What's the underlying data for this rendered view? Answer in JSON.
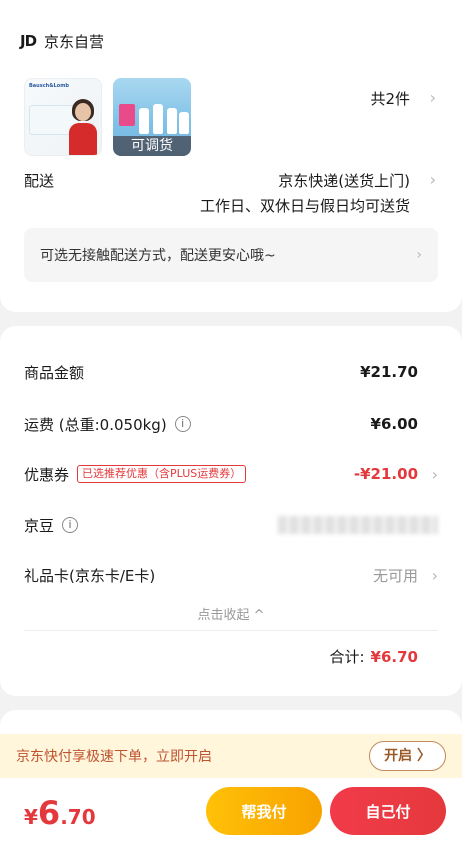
{
  "store": {
    "logo": "JD",
    "name": "京东自营"
  },
  "products": {
    "thumb1_brand": "Bausch&Lomb",
    "thumb2_badge": "可调货",
    "count_text": "共2件"
  },
  "delivery": {
    "label": "配送",
    "method": "京东快递(送货上门)",
    "schedule": "工作日、双休日与假日均可送货",
    "contactless": "可选无接触配送方式，配送更安心哦~"
  },
  "fees": {
    "goods_label": "商品金额",
    "goods_value": "¥21.70",
    "shipping_label": "运费 (总重:0.050kg)",
    "shipping_value": "¥6.00",
    "coupon_label": "优惠券",
    "coupon_tag": "已选推荐优惠（含PLUS运费券）",
    "coupon_value": "-¥21.00",
    "jingdou_label": "京豆",
    "giftcard_label": "礼品卡(京东卡/E卡)",
    "giftcard_value": "无可用",
    "collapse_text": "点击收起 ^",
    "total_label": "合计:",
    "total_value": "¥6.70"
  },
  "promo": {
    "text": "京东快付享极速下单，立即开启",
    "button": "开启 〉"
  },
  "payment": {
    "currency": "¥",
    "amount_int": "6",
    "amount_dec": ".70",
    "help_pay": "帮我付",
    "self_pay": "自己付"
  },
  "colors": {
    "accent_red": "#e4393c",
    "accent_yellow": "#ffc107"
  },
  "icons": {
    "info": "info-circle-icon",
    "chevron": "chevron-right-icon"
  }
}
